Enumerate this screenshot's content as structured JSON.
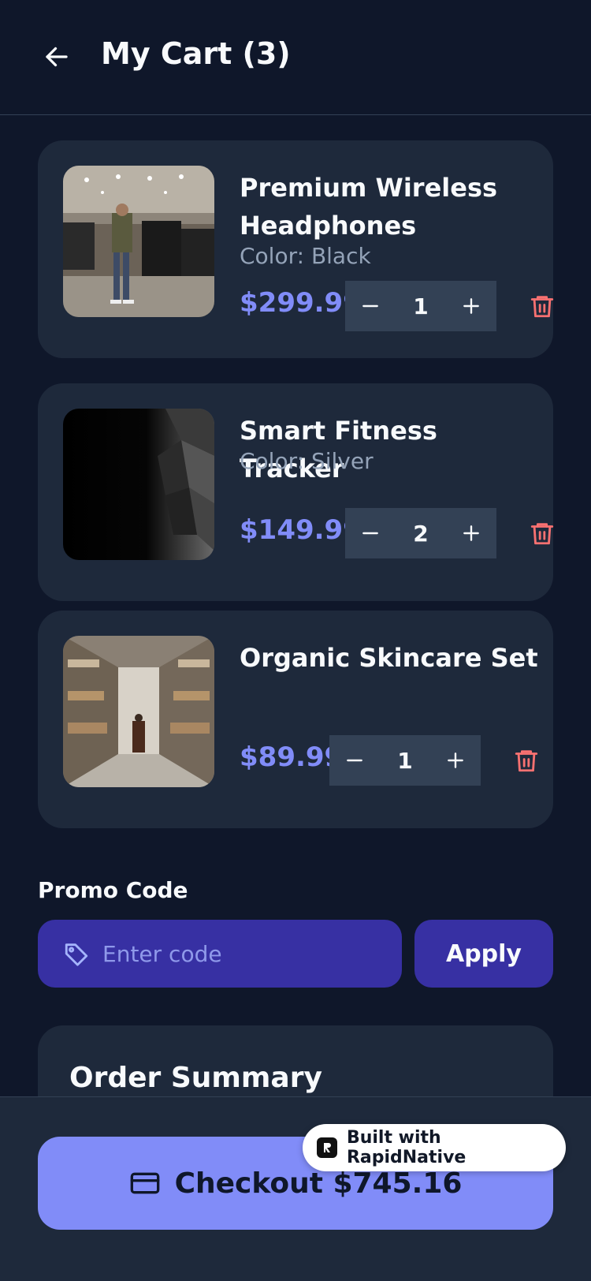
{
  "header": {
    "title": "My Cart (3)",
    "back_icon": "arrow-left-icon"
  },
  "cart_items": [
    {
      "name": "Premium Wireless Headphones",
      "color": "Color: Black",
      "price": "$299.99",
      "quantity": "1"
    },
    {
      "name": "Smart Fitness Tracker",
      "color": "Color: Silver",
      "price": "$149.99",
      "quantity": "2"
    },
    {
      "name": "Organic Skincare Set",
      "color": "",
      "price": "$89.99",
      "quantity": "1"
    }
  ],
  "promo": {
    "label": "Promo Code",
    "placeholder": "Enter code",
    "apply_label": "Apply",
    "icon": "tag-icon"
  },
  "summary": {
    "title": "Order Summary"
  },
  "checkout": {
    "label": "Checkout $745.16",
    "icon": "credit-card-icon"
  },
  "badge": {
    "text": "Built with RapidNative"
  },
  "colors": {
    "background": "#0f172a",
    "card": "#1e293b",
    "accent": "#818cf8",
    "promo": "#3730a3",
    "danger": "#f87171"
  }
}
